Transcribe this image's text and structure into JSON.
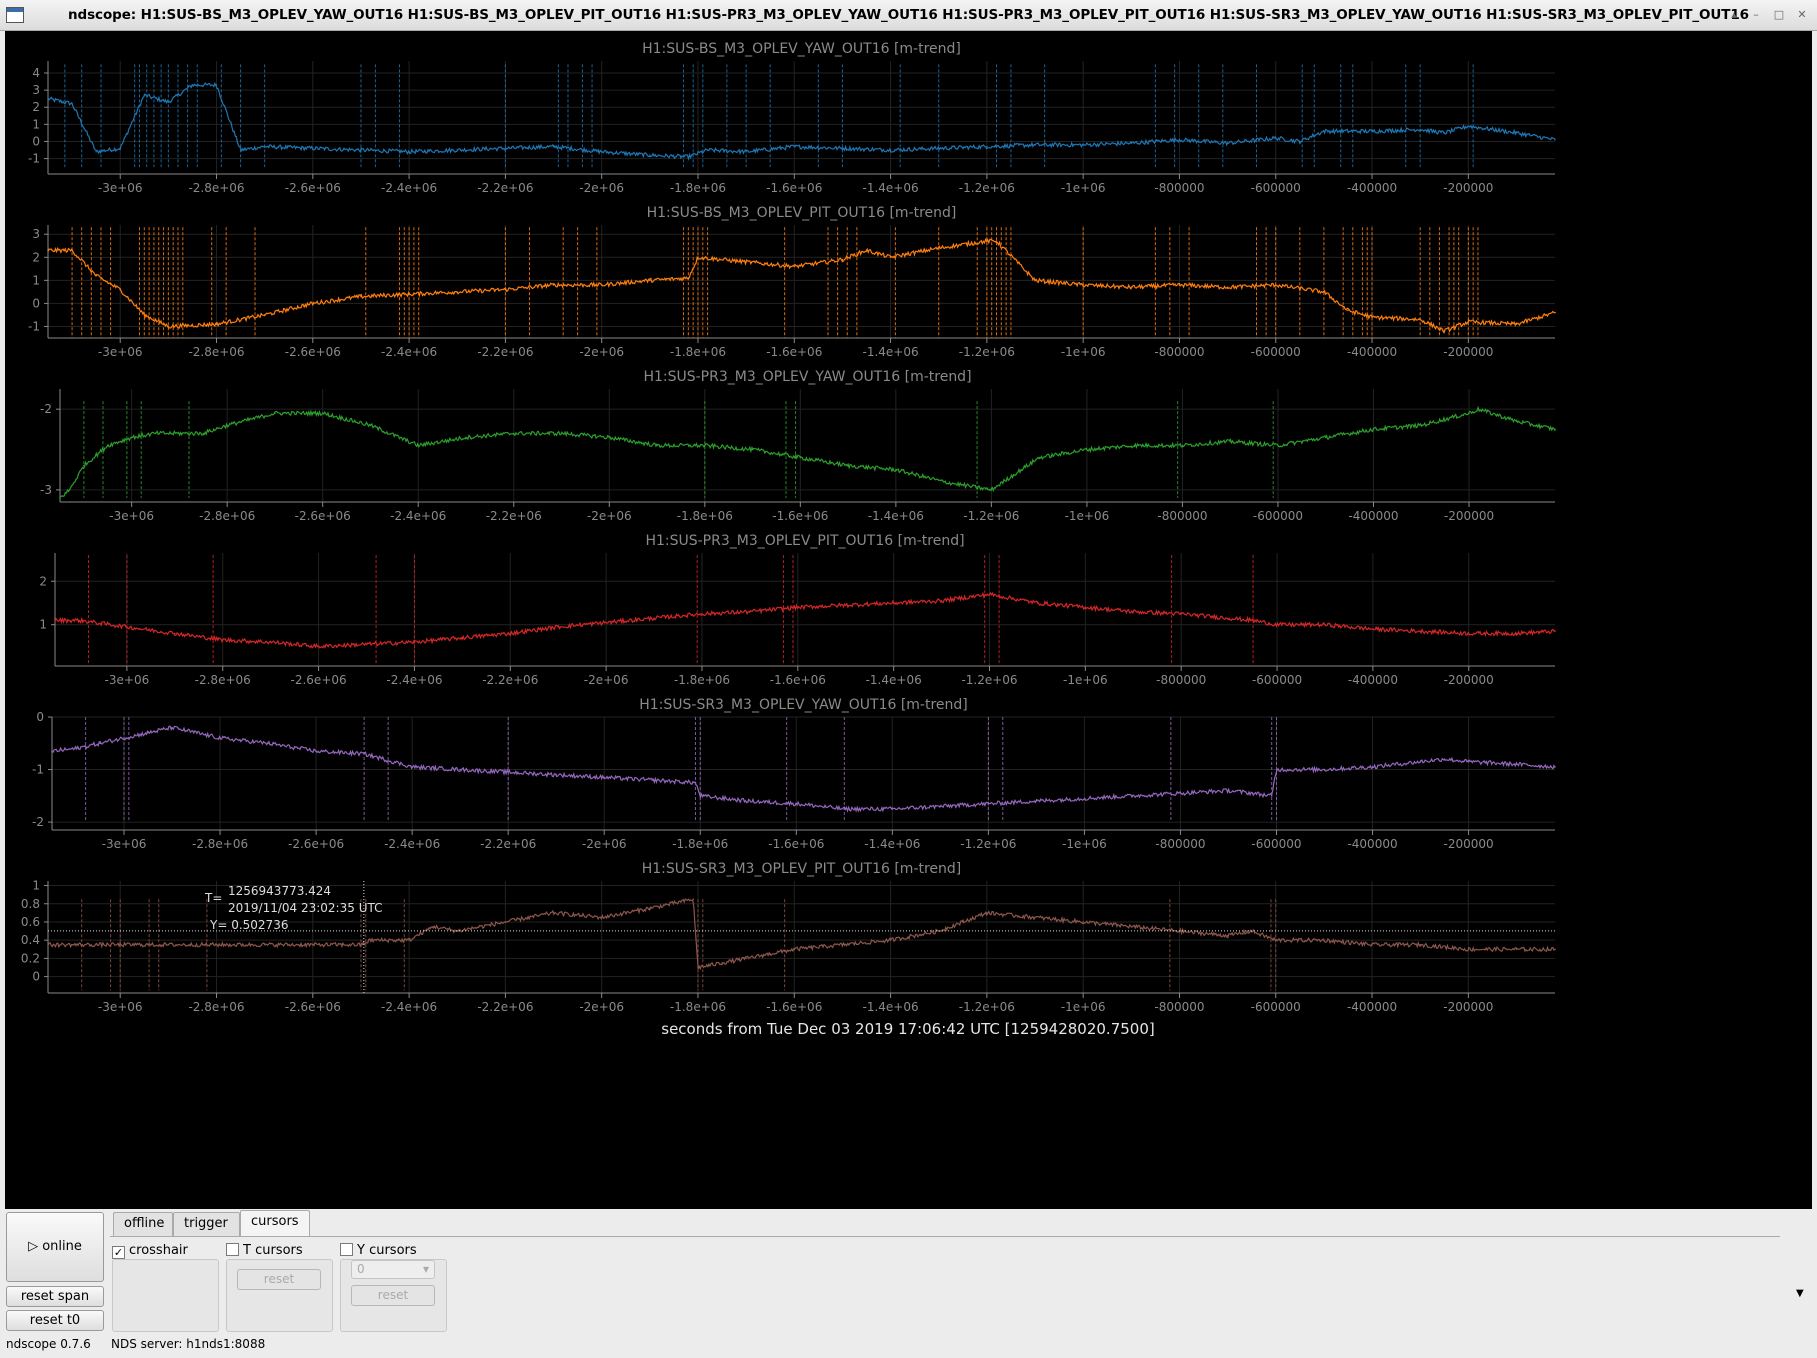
{
  "window": {
    "title": "ndscope: H1:SUS-BS_M3_OPLEV_YAW_OUT16 H1:SUS-BS_M3_OPLEV_PIT_OUT16 H1:SUS-PR3_M3_OPLEV_YAW_OUT16 H1:SUS-PR3_M3_OPLEV_PIT_OUT16 H1:SUS-SR3_M3_OPLEV_YAW_OUT16 H1:SUS-SR3_M3_OPLEV_PIT_OUT16",
    "buttons": [
      "▴",
      "–",
      "□",
      "✕"
    ]
  },
  "xaxis": {
    "min": -3150000,
    "max": -20000,
    "ticks": [
      -3000000,
      -2800000,
      -2600000,
      -2400000,
      -2200000,
      -2000000,
      -1800000,
      -1600000,
      -1400000,
      -1200000,
      -1000000,
      -800000,
      -600000,
      -400000,
      -200000
    ],
    "tick_labels": [
      "-3e+06",
      "-2.8e+06",
      "-2.6e+06",
      "-2.4e+06",
      "-2.2e+06",
      "-2e+06",
      "-1.8e+06",
      "-1.6e+06",
      "-1.4e+06",
      "-1.2e+06",
      "-1e+06",
      "-800000",
      "-600000",
      "-400000",
      "-200000"
    ],
    "label": "seconds from Tue Dec 03 2019 17:06:42 UTC [1259428020.7500]"
  },
  "chart_data": [
    {
      "type": "line",
      "title": "H1:SUS-BS_M3_OPLEV_YAW_OUT16 [m-trend]",
      "color": "#1f77b4",
      "ylim": [
        -1.9,
        4.7
      ],
      "yticks": [
        -1,
        0,
        1,
        2,
        3,
        4
      ],
      "ytick_labels": [
        "-1",
        "0",
        "1",
        "2",
        "3",
        "4"
      ],
      "spike_range": [
        -1.5,
        4.5
      ],
      "series": [
        {
          "x": [
            -3150000,
            -3100000,
            -3050000,
            -3000000,
            -2950000,
            -2900000,
            -2850000,
            -2800000,
            -2750000,
            -2700000,
            -2600000,
            -2500000,
            -2400000,
            -2300000,
            -2200000,
            -2100000,
            -2000000,
            -1900000,
            -1820000,
            -1780000,
            -1700000,
            -1600000,
            -1500000,
            -1400000,
            -1300000,
            -1200000,
            -1100000,
            -1000000,
            -900000,
            -800000,
            -700000,
            -600000,
            -550000,
            -500000,
            -400000,
            -300000,
            -250000,
            -200000,
            -100000,
            -20000
          ],
          "values": [
            2.5,
            2.2,
            -0.6,
            -0.4,
            2.7,
            2.3,
            3.3,
            3.3,
            -0.5,
            -0.3,
            -0.4,
            -0.5,
            -0.6,
            -0.5,
            -0.4,
            -0.3,
            -0.6,
            -0.8,
            -0.9,
            -0.5,
            -0.6,
            -0.3,
            -0.4,
            -0.5,
            -0.4,
            -0.3,
            -0.2,
            -0.2,
            -0.1,
            0.1,
            -0.1,
            0.2,
            0.0,
            0.6,
            0.6,
            0.7,
            0.5,
            0.9,
            0.5,
            0.1
          ]
        }
      ],
      "spikes": [
        -3115000,
        -3080000,
        -3040000,
        -2970000,
        -2960000,
        -2945000,
        -2930000,
        -2915000,
        -2900000,
        -2880000,
        -2860000,
        -2840000,
        -2790000,
        -2750000,
        -2700000,
        -2500000,
        -2470000,
        -2420000,
        -2200000,
        -2090000,
        -2070000,
        -2040000,
        -2020000,
        -1830000,
        -1810000,
        -1790000,
        -1740000,
        -1700000,
        -1650000,
        -1550000,
        -1500000,
        -1380000,
        -1300000,
        -1180000,
        -1150000,
        -1080000,
        -850000,
        -810000,
        -760000,
        -710000,
        -640000,
        -545000,
        -520000,
        -465000,
        -440000,
        -330000,
        -300000,
        -190000
      ]
    },
    {
      "type": "line",
      "title": "H1:SUS-BS_M3_OPLEV_PIT_OUT16 [m-trend]",
      "color": "#ff7f0e",
      "ylim": [
        -1.5,
        3.4
      ],
      "yticks": [
        -1,
        0,
        1,
        2,
        3
      ],
      "ytick_labels": [
        "-1",
        "0",
        "1",
        "2",
        "3"
      ],
      "spike_range": [
        -1.5,
        3.3
      ],
      "series": [
        {
          "x": [
            -3150000,
            -3100000,
            -3050000,
            -3000000,
            -2950000,
            -2900000,
            -2800000,
            -2700000,
            -2600000,
            -2500000,
            -2400000,
            -2300000,
            -2200000,
            -2100000,
            -2000000,
            -1900000,
            -1820000,
            -1800000,
            -1700000,
            -1600000,
            -1500000,
            -1450000,
            -1400000,
            -1300000,
            -1200000,
            -1180000,
            -1100000,
            -1000000,
            -900000,
            -800000,
            -700000,
            -600000,
            -500000,
            -450000,
            -400000,
            -300000,
            -250000,
            -200000,
            -100000,
            -20000
          ],
          "values": [
            2.3,
            2.3,
            1.2,
            0.6,
            -0.5,
            -1.0,
            -0.9,
            -0.5,
            0.0,
            0.3,
            0.4,
            0.5,
            0.6,
            0.8,
            0.8,
            1.0,
            1.1,
            2.0,
            1.8,
            1.6,
            1.9,
            2.3,
            2.0,
            2.4,
            2.7,
            2.7,
            1.0,
            0.8,
            0.7,
            0.8,
            0.7,
            0.8,
            0.5,
            -0.3,
            -0.6,
            -0.7,
            -1.2,
            -0.8,
            -0.9,
            -0.4
          ]
        }
      ],
      "spikes": [
        -3100000,
        -3080000,
        -3060000,
        -3040000,
        -3020000,
        -2960000,
        -2950000,
        -2940000,
        -2930000,
        -2920000,
        -2910000,
        -2900000,
        -2890000,
        -2880000,
        -2870000,
        -2810000,
        -2780000,
        -2720000,
        -2490000,
        -2420000,
        -2410000,
        -2400000,
        -2390000,
        -2380000,
        -2200000,
        -2150000,
        -2080000,
        -2050000,
        -2010000,
        -1830000,
        -1820000,
        -1810000,
        -1800000,
        -1790000,
        -1780000,
        -1620000,
        -1530000,
        -1510000,
        -1490000,
        -1470000,
        -1390000,
        -1300000,
        -1220000,
        -1200000,
        -1190000,
        -1180000,
        -1170000,
        -1160000,
        -1150000,
        -1000000,
        -850000,
        -820000,
        -780000,
        -640000,
        -620000,
        -600000,
        -550000,
        -500000,
        -460000,
        -440000,
        -420000,
        -410000,
        -400000,
        -300000,
        -280000,
        -260000,
        -240000,
        -230000,
        -220000,
        -200000,
        -190000,
        -180000
      ]
    },
    {
      "type": "line",
      "title": "H1:SUS-PR3_M3_OPLEV_YAW_OUT16 [m-trend]",
      "color": "#2ca02c",
      "ylim": [
        -3.15,
        -1.75
      ],
      "yticks": [
        -3,
        -2
      ],
      "ytick_labels": [
        "-3",
        "-2"
      ],
      "spike_range": [
        -3.1,
        -1.9
      ],
      "series": [
        {
          "x": [
            -3150000,
            -3130000,
            -3100000,
            -3050000,
            -3000000,
            -2950000,
            -2900000,
            -2850000,
            -2800000,
            -2700000,
            -2600000,
            -2500000,
            -2400000,
            -2300000,
            -2200000,
            -2100000,
            -2000000,
            -1900000,
            -1800000,
            -1700000,
            -1600000,
            -1500000,
            -1400000,
            -1300000,
            -1200000,
            -1100000,
            -1000000,
            -900000,
            -800000,
            -700000,
            -600000,
            -500000,
            -400000,
            -300000,
            -200000,
            -180000,
            -100000,
            -20000
          ],
          "values": [
            -3.1,
            -3.0,
            -2.7,
            -2.45,
            -2.35,
            -2.3,
            -2.3,
            -2.3,
            -2.2,
            -2.05,
            -2.05,
            -2.2,
            -2.45,
            -2.35,
            -2.3,
            -2.3,
            -2.35,
            -2.45,
            -2.45,
            -2.5,
            -2.6,
            -2.7,
            -2.75,
            -2.9,
            -3.0,
            -2.6,
            -2.5,
            -2.45,
            -2.45,
            -2.4,
            -2.45,
            -2.35,
            -2.25,
            -2.2,
            -2.05,
            -2.0,
            -2.15,
            -2.25
          ]
        }
      ],
      "spikes": [
        -3100000,
        -3060000,
        -3010000,
        -2980000,
        -2880000,
        -1800000,
        -1630000,
        -1610000,
        -1230000,
        -810000,
        -610000
      ]
    },
    {
      "type": "line",
      "title": "H1:SUS-PR3_M3_OPLEV_PIT_OUT16 [m-trend]",
      "color": "#d62728",
      "ylim": [
        0.05,
        2.65
      ],
      "yticks": [
        1,
        2
      ],
      "ytick_labels": [
        "1",
        "2"
      ],
      "spike_range": [
        0.1,
        2.6
      ],
      "series": [
        {
          "x": [
            -3150000,
            -3100000,
            -3000000,
            -2900000,
            -2800000,
            -2700000,
            -2600000,
            -2500000,
            -2400000,
            -2300000,
            -2200000,
            -2100000,
            -2000000,
            -1900000,
            -1800000,
            -1700000,
            -1600000,
            -1500000,
            -1400000,
            -1300000,
            -1200000,
            -1150000,
            -1100000,
            -1000000,
            -900000,
            -800000,
            -700000,
            -650000,
            -600000,
            -500000,
            -400000,
            -300000,
            -200000,
            -100000,
            -20000
          ],
          "values": [
            1.1,
            1.1,
            0.95,
            0.8,
            0.65,
            0.6,
            0.5,
            0.55,
            0.6,
            0.7,
            0.8,
            0.95,
            1.05,
            1.15,
            1.25,
            1.3,
            1.4,
            1.45,
            1.5,
            1.55,
            1.7,
            1.6,
            1.5,
            1.4,
            1.3,
            1.25,
            1.15,
            1.1,
            1.0,
            1.0,
            0.9,
            0.85,
            0.8,
            0.8,
            0.85
          ]
        }
      ],
      "spikes": [
        -3080000,
        -3000000,
        -2820000,
        -2480000,
        -2400000,
        -1810000,
        -1630000,
        -1610000,
        -1210000,
        -1180000,
        -820000,
        -650000
      ]
    },
    {
      "type": "line",
      "title": "H1:SUS-SR3_M3_OPLEV_YAW_OUT16 [m-trend]",
      "color": "#9467bd",
      "ylim": [
        -2.15,
        0.0
      ],
      "yticks": [
        -2,
        -1,
        0
      ],
      "ytick_labels": [
        "-2",
        "-1",
        "0"
      ],
      "spike_range": [
        -2.0,
        0.0
      ],
      "series": [
        {
          "x": [
            -3150000,
            -3100000,
            -3050000,
            -3000000,
            -2950000,
            -2900000,
            -2800000,
            -2700000,
            -2600000,
            -2500000,
            -2400000,
            -2300000,
            -2200000,
            -2100000,
            -2000000,
            -1900000,
            -1810000,
            -1800000,
            -1700000,
            -1600000,
            -1500000,
            -1400000,
            -1300000,
            -1200000,
            -1100000,
            -1000000,
            -900000,
            -800000,
            -700000,
            -650000,
            -610000,
            -600000,
            -500000,
            -400000,
            -300000,
            -250000,
            -200000,
            -100000,
            -20000
          ],
          "values": [
            -0.65,
            -0.6,
            -0.5,
            -0.4,
            -0.3,
            -0.2,
            -0.4,
            -0.5,
            -0.65,
            -0.7,
            -0.95,
            -1.0,
            -1.05,
            -1.1,
            -1.15,
            -1.2,
            -1.25,
            -1.5,
            -1.6,
            -1.65,
            -1.75,
            -1.75,
            -1.7,
            -1.65,
            -1.6,
            -1.55,
            -1.5,
            -1.45,
            -1.4,
            -1.45,
            -1.5,
            -1.0,
            -1.0,
            -0.95,
            -0.85,
            -0.8,
            -0.85,
            -0.9,
            -0.95
          ]
        }
      ],
      "spikes": [
        -3080000,
        -3000000,
        -2990000,
        -2500000,
        -2450000,
        -2200000,
        -1810000,
        -1800000,
        -1620000,
        -1500000,
        -1200000,
        -1170000,
        -820000,
        -610000,
        -600000
      ]
    },
    {
      "type": "line",
      "title": "H1:SUS-SR3_M3_OPLEV_PIT_OUT16 [m-trend]",
      "color": "#8c564b",
      "ylim": [
        -0.18,
        1.05
      ],
      "yticks": [
        0,
        0.2,
        0.4,
        0.6,
        0.8,
        1
      ],
      "ytick_labels": [
        "0",
        "0.2",
        "0.4",
        "0.6",
        "0.8",
        "1"
      ],
      "spike_range": [
        -0.15,
        0.85
      ],
      "series": [
        {
          "x": [
            -3150000,
            -3100000,
            -3000000,
            -2900000,
            -2800000,
            -2700000,
            -2600000,
            -2500000,
            -2480000,
            -2400000,
            -2350000,
            -2300000,
            -2200000,
            -2100000,
            -2000000,
            -1900000,
            -1810000,
            -1800000,
            -1750000,
            -1700000,
            -1650000,
            -1600000,
            -1500000,
            -1400000,
            -1300000,
            -1250000,
            -1200000,
            -1100000,
            -1000000,
            -900000,
            -800000,
            -700000,
            -650000,
            -600000,
            -500000,
            -400000,
            -300000,
            -200000,
            -100000,
            -20000
          ],
          "values": [
            0.35,
            0.35,
            0.35,
            0.35,
            0.35,
            0.35,
            0.35,
            0.35,
            0.4,
            0.4,
            0.55,
            0.5,
            0.6,
            0.7,
            0.65,
            0.75,
            0.85,
            0.1,
            0.15,
            0.2,
            0.25,
            0.3,
            0.35,
            0.4,
            0.5,
            0.6,
            0.7,
            0.65,
            0.6,
            0.55,
            0.5,
            0.45,
            0.5,
            0.4,
            0.4,
            0.35,
            0.35,
            0.3,
            0.3,
            0.3
          ]
        }
      ],
      "spikes": [
        -3080000,
        -3020000,
        -3000000,
        -2940000,
        -2920000,
        -2820000,
        -2500000,
        -2490000,
        -2410000,
        -1800000,
        -1790000,
        -1620000,
        -820000,
        -610000,
        -600000
      ],
      "crosshair": {
        "label_T": "T=",
        "label_Y": "Y=",
        "t_value": "1256943773.424",
        "t_utc": "2019/11/04 23:02:35 UTC",
        "y_value": "Y= 0.502736",
        "x": -2494000,
        "y": 0.502736
      }
    }
  ],
  "controls": {
    "online_button": "▷ online",
    "reset_span_button": "reset span",
    "reset_t0_button": "reset t0",
    "tabs": [
      "offline",
      "trigger",
      "cursors"
    ],
    "active_tab": "cursors",
    "crosshair_label": "crosshair",
    "crosshair_checked": "✓",
    "t_cursors_label": "T cursors",
    "y_cursors_label": "Y cursors",
    "t_reset": "reset",
    "y_select_value": "0",
    "y_reset": "reset"
  },
  "status": {
    "version": "ndscope 0.7.6",
    "server": "NDS server: h1nds1:8088"
  }
}
